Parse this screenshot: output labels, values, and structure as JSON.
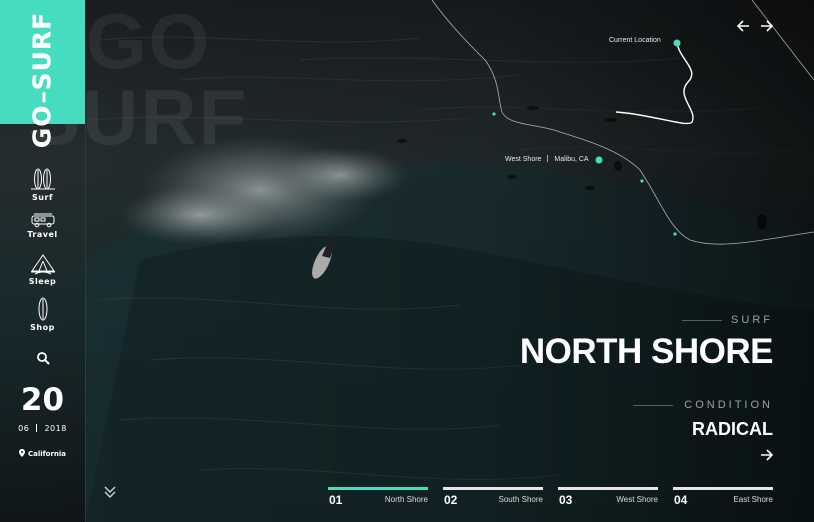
{
  "brand": {
    "word1": "GO",
    "word2": "SURF",
    "accent_color": "#46dcc0"
  },
  "watermark": {
    "top": "GO",
    "bottom": "SURF"
  },
  "nav": [
    {
      "label": "Surf",
      "icon": "surfboards-icon"
    },
    {
      "label": "Travel",
      "icon": "van-icon"
    },
    {
      "label": "Sleep",
      "icon": "tent-icon"
    },
    {
      "label": "Shop",
      "icon": "surfboard-icon"
    }
  ],
  "search": {
    "icon": "search-icon"
  },
  "date": {
    "day": "20",
    "month": "06",
    "year": "2018"
  },
  "location": {
    "icon": "map-pin-icon",
    "label": "California"
  },
  "map": {
    "current_location": "Current Location",
    "west_shore": "West Shore",
    "west_shore_place": "Malibu, CA"
  },
  "pager": {
    "prev_icon": "arrow-left-icon",
    "next_icon": "arrow-right-icon"
  },
  "hero": {
    "eyebrow": "SURF",
    "title": "NORTH SHORE",
    "condition_label": "CONDITION",
    "condition_value": "RADICAL",
    "next_icon": "arrow-right-icon"
  },
  "tabs": [
    {
      "num": "01",
      "label": "North Shore",
      "active": true
    },
    {
      "num": "02",
      "label": "South Shore",
      "active": false
    },
    {
      "num": "03",
      "label": "West Shore",
      "active": false
    },
    {
      "num": "04",
      "label": "East Shore",
      "active": false
    }
  ],
  "scroll": {
    "icon": "double-chevron-down-icon"
  }
}
